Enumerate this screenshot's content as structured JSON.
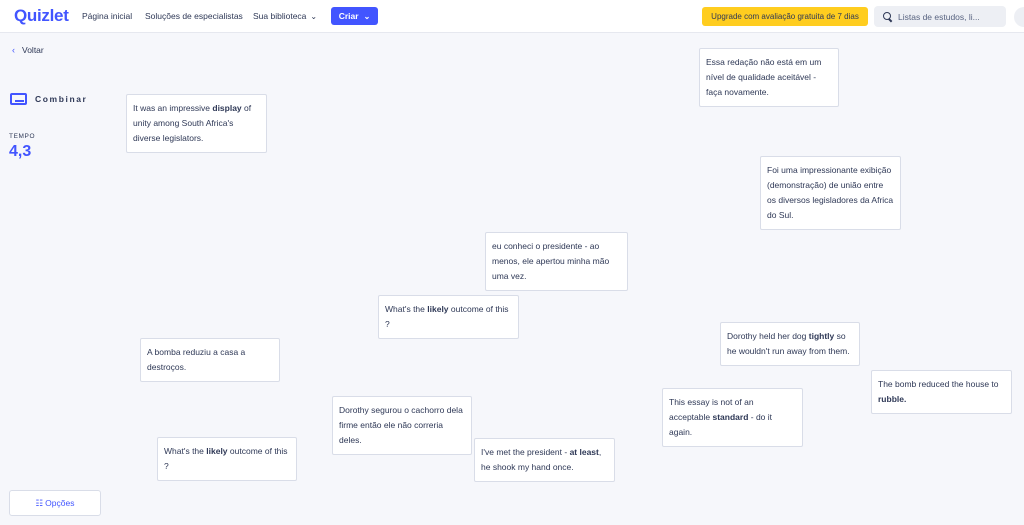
{
  "header": {
    "logo": "Quizlet",
    "nav": [
      "Página inicial",
      "Soluções de especialistas",
      "Sua biblioteca"
    ],
    "create_label": "Criar",
    "upgrade_label": "Upgrade com avaliação gratuita de 7 dias",
    "search_placeholder": "Listas de estudos, li..."
  },
  "sidebar": {
    "back_label": "Voltar",
    "mode_label": "Combinar",
    "time_label": "TEMPO",
    "time_value": "4,3",
    "options_label": "Opções"
  },
  "cards": [
    {
      "name": "card-essay-pt",
      "segments": [
        {
          "t": "Essa redação não está em um nível de qualidade aceitável - faça novamente."
        }
      ]
    },
    {
      "name": "card-display-en",
      "segments": [
        {
          "t": "It was an impressive "
        },
        {
          "t": "display",
          "b": true
        },
        {
          "t": " of unity among South Africa's diverse legislators."
        }
      ]
    },
    {
      "name": "card-display-pt",
      "segments": [
        {
          "t": "Foi uma impressionante exibição (demonstração) de união entre os diversos legisladores da Africa do Sul."
        }
      ]
    },
    {
      "name": "card-president-pt",
      "segments": [
        {
          "t": "eu conheci o presidente - ao menos, ele apertou minha mão uma vez."
        }
      ]
    },
    {
      "name": "card-likely-en-1",
      "segments": [
        {
          "t": "What's the "
        },
        {
          "t": "likely",
          "b": true
        },
        {
          "t": " outcome of this ?"
        }
      ]
    },
    {
      "name": "card-tightly-en",
      "segments": [
        {
          "t": "Dorothy held her dog "
        },
        {
          "t": "tightly",
          "b": true
        },
        {
          "t": " so he wouldn't run away from them."
        }
      ]
    },
    {
      "name": "card-bomb-pt",
      "segments": [
        {
          "t": "A bomba reduziu a casa a destroços."
        }
      ]
    },
    {
      "name": "card-rubble-en",
      "segments": [
        {
          "t": "The bomb reduced the house to "
        },
        {
          "t": "rubble.",
          "b": true
        }
      ]
    },
    {
      "name": "card-standard-en",
      "segments": [
        {
          "t": "This essay is not of an acceptable "
        },
        {
          "t": "standard",
          "b": true
        },
        {
          "t": " - do it again."
        }
      ]
    },
    {
      "name": "card-tightly-pt",
      "segments": [
        {
          "t": "Dorothy segurou o cachorro dela firme então ele não correria deles."
        }
      ]
    },
    {
      "name": "card-likely-en-2",
      "segments": [
        {
          "t": "What's the "
        },
        {
          "t": "likely",
          "b": true
        },
        {
          "t": " outcome of this ?"
        }
      ]
    },
    {
      "name": "card-atleast-en",
      "segments": [
        {
          "t": "I've met the president - "
        },
        {
          "t": "at least",
          "b": true
        },
        {
          "t": ", he shook my hand once."
        }
      ]
    }
  ]
}
